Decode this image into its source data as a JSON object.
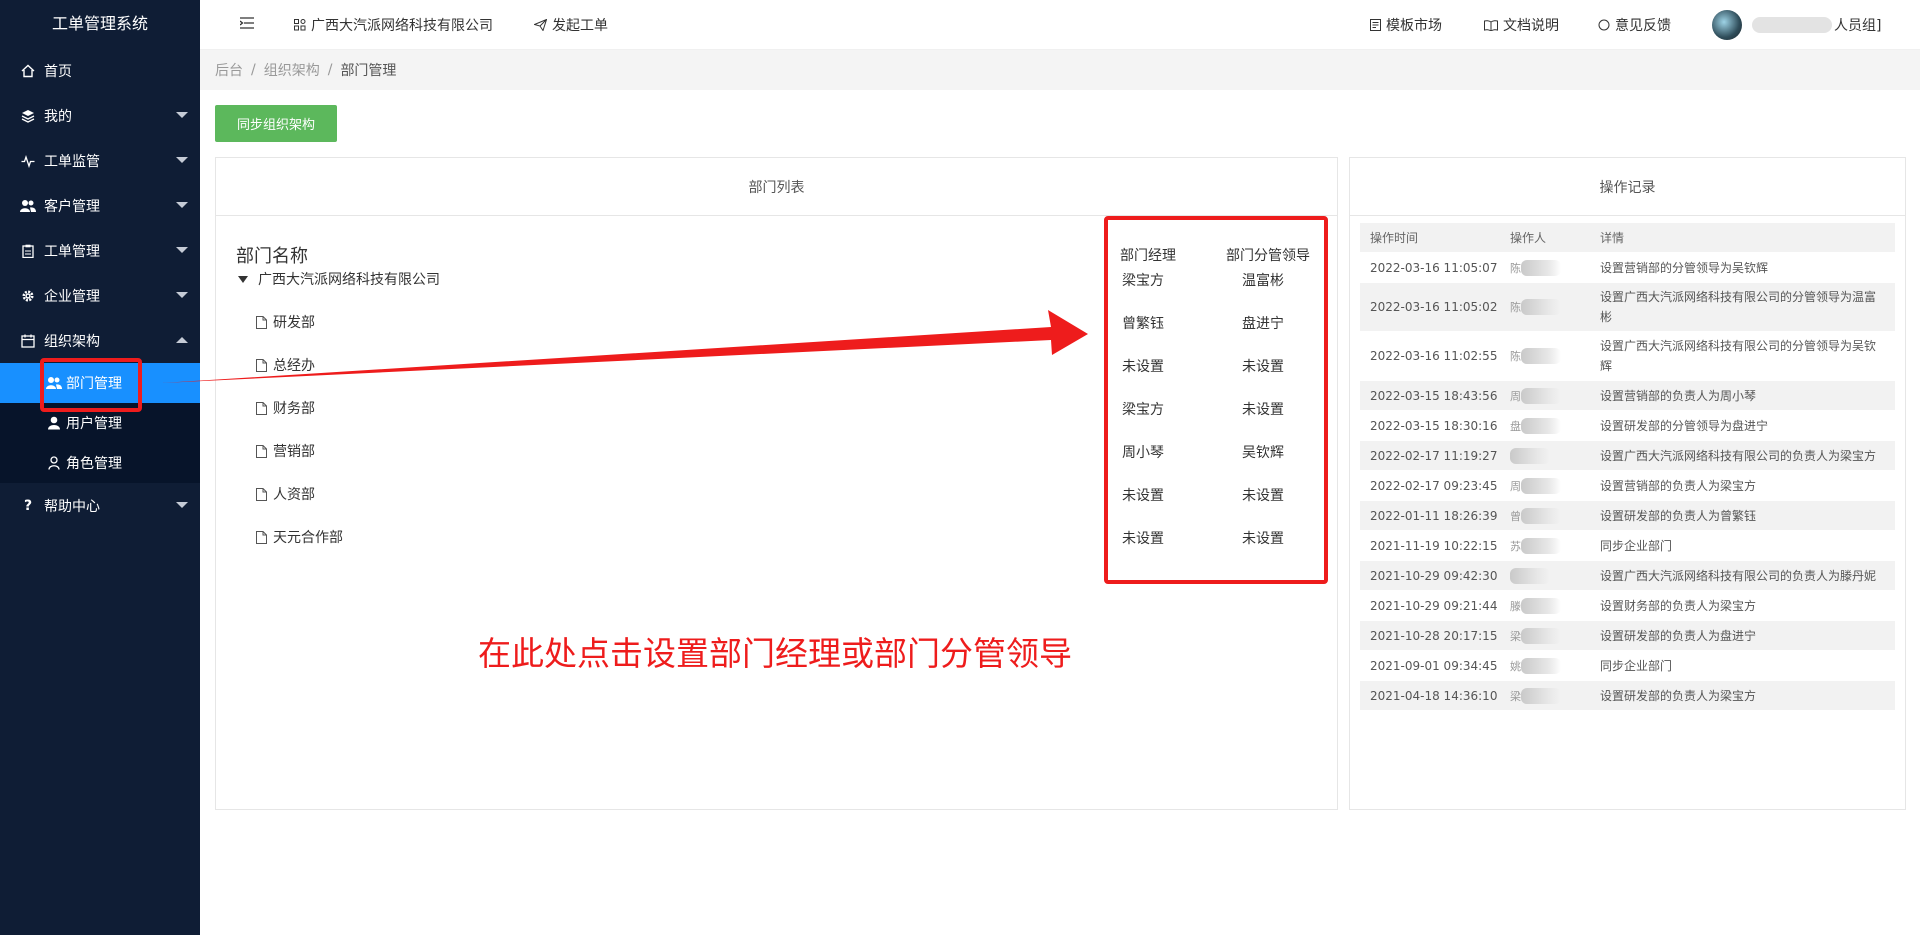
{
  "sidebar": {
    "title": "工单管理系统",
    "items": [
      {
        "label": "首页"
      },
      {
        "label": "我的"
      },
      {
        "label": "工单监管"
      },
      {
        "label": "客户管理"
      },
      {
        "label": "工单管理"
      },
      {
        "label": "企业管理"
      },
      {
        "label": "组织架构"
      },
      {
        "label": "帮助中心"
      }
    ],
    "sub_items": [
      {
        "label": "部门管理"
      },
      {
        "label": "用户管理"
      },
      {
        "label": "角色管理"
      }
    ],
    "active_color": "#1890ff",
    "background": "#0f1d35"
  },
  "header": {
    "company": "广西大汽派网络科技有限公司",
    "create_ticket": "发起工单",
    "template_market": "模板市场",
    "docs": "文档说明",
    "feedback": "意见反馈",
    "user_suffix": "人员组]"
  },
  "breadcrumb": [
    "后台",
    "组织架构",
    "部门管理"
  ],
  "main": {
    "sync_button": "同步组织架构",
    "dept_panel_title": "部门列表",
    "dept_name_header": "部门名称",
    "manager_header": "部门经理",
    "leader_header": "部门分管领导",
    "root": {
      "name": "广西大汽派网络科技有限公司",
      "manager": "梁宝方",
      "leader": "温富彬"
    },
    "departments": [
      {
        "name": "研发部",
        "manager": "曾繁钰",
        "leader": "盘进宁"
      },
      {
        "name": "总经办",
        "manager": "未设置",
        "leader": "未设置"
      },
      {
        "name": "财务部",
        "manager": "梁宝方",
        "leader": "未设置"
      },
      {
        "name": "营销部",
        "manager": "周小琴",
        "leader": "吴钦辉"
      },
      {
        "name": "人资部",
        "manager": "未设置",
        "leader": "未设置"
      },
      {
        "name": "天元合作部",
        "manager": "未设置",
        "leader": "未设置"
      }
    ]
  },
  "log_panel": {
    "title": "操作记录",
    "headers": [
      "操作时间",
      "操作人",
      "详情"
    ],
    "rows": [
      {
        "time": "2022-03-16 11:05:07",
        "operator_hint": "陈",
        "detail": "设置营销部的分管领导为吴钦辉"
      },
      {
        "time": "2022-03-16 11:05:02",
        "operator_hint": "陈",
        "detail": "设置广西大汽派网络科技有限公司的分管领导为温富彬"
      },
      {
        "time": "2022-03-16 11:02:55",
        "operator_hint": "陈",
        "detail": "设置广西大汽派网络科技有限公司的分管领导为吴钦辉"
      },
      {
        "time": "2022-03-15 18:43:56",
        "operator_hint": "周",
        "detail": "设置营销部的负责人为周小琴"
      },
      {
        "time": "2022-03-15 18:30:16",
        "operator_hint": "盘",
        "detail": "设置研发部的分管领导为盘进宁"
      },
      {
        "time": "2022-02-17 11:19:27",
        "operator_hint": "",
        "detail": "设置广西大汽派网络科技有限公司的负责人为梁宝方"
      },
      {
        "time": "2022-02-17 09:23:45",
        "operator_hint": "周",
        "detail": "设置营销部的负责人为梁宝方"
      },
      {
        "time": "2022-01-11 18:26:39",
        "operator_hint": "曾",
        "detail": "设置研发部的负责人为曾繁钰"
      },
      {
        "time": "2021-11-19 10:22:15",
        "operator_hint": "苏",
        "detail": "同步企业部门"
      },
      {
        "time": "2021-10-29 09:42:30",
        "operator_hint": "",
        "detail": "设置广西大汽派网络科技有限公司的负责人为滕丹妮"
      },
      {
        "time": "2021-10-29 09:21:44",
        "operator_hint": "滕",
        "detail": "设置财务部的负责人为梁宝方"
      },
      {
        "time": "2021-10-28 20:17:15",
        "operator_hint": "梁",
        "detail": "设置研发部的负责人为盘进宁"
      },
      {
        "time": "2021-09-01 09:34:45",
        "operator_hint": "姚",
        "detail": "同步企业部门"
      },
      {
        "time": "2021-04-18 14:36:10",
        "operator_hint": "梁",
        "detail": "设置研发部的负责人为梁宝方"
      }
    ]
  },
  "annotation": {
    "text": "在此处点击设置部门经理或部门分管领导",
    "color": "#ee1c1c"
  }
}
